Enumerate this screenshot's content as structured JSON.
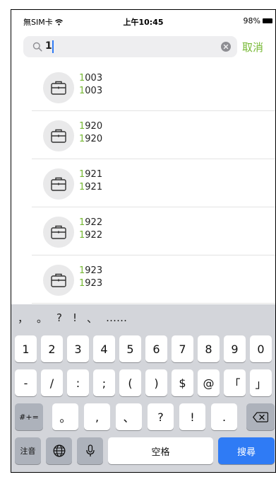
{
  "status": {
    "carrier": "無SIM卡",
    "time": "上午10:45",
    "battery": "98%"
  },
  "search": {
    "query": "1",
    "cancel": "取消"
  },
  "results": [
    {
      "match": "1",
      "rest": "003",
      "match2": "1",
      "rest2": "003"
    },
    {
      "match": "1",
      "rest": "920",
      "match2": "1",
      "rest2": "920"
    },
    {
      "match": "1",
      "rest": "921",
      "match2": "1",
      "rest2": "921"
    },
    {
      "match": "1",
      "rest": "922",
      "match2": "1",
      "rest2": "922"
    },
    {
      "match": "1",
      "rest": "923",
      "match2": "1",
      "rest2": "923"
    }
  ],
  "keyboard": {
    "candidates": [
      "，",
      "。",
      "?",
      "!",
      "、",
      "……"
    ],
    "row1": [
      "1",
      "2",
      "3",
      "4",
      "5",
      "6",
      "7",
      "8",
      "9",
      "0"
    ],
    "row2": [
      "-",
      "/",
      ":",
      ";",
      "(",
      ")",
      "$",
      "@",
      "「",
      "」"
    ],
    "row3": {
      "toggle": "#+=",
      "keys": [
        "。",
        ",",
        "、",
        "?",
        "!",
        "."
      ]
    },
    "row4": {
      "lang": "注音",
      "space": "空格",
      "search": "搜尋"
    }
  },
  "colors": {
    "accent": "#76b833",
    "keyboard_bg": "#d3d5da",
    "search_key": "#2f7bf5"
  }
}
